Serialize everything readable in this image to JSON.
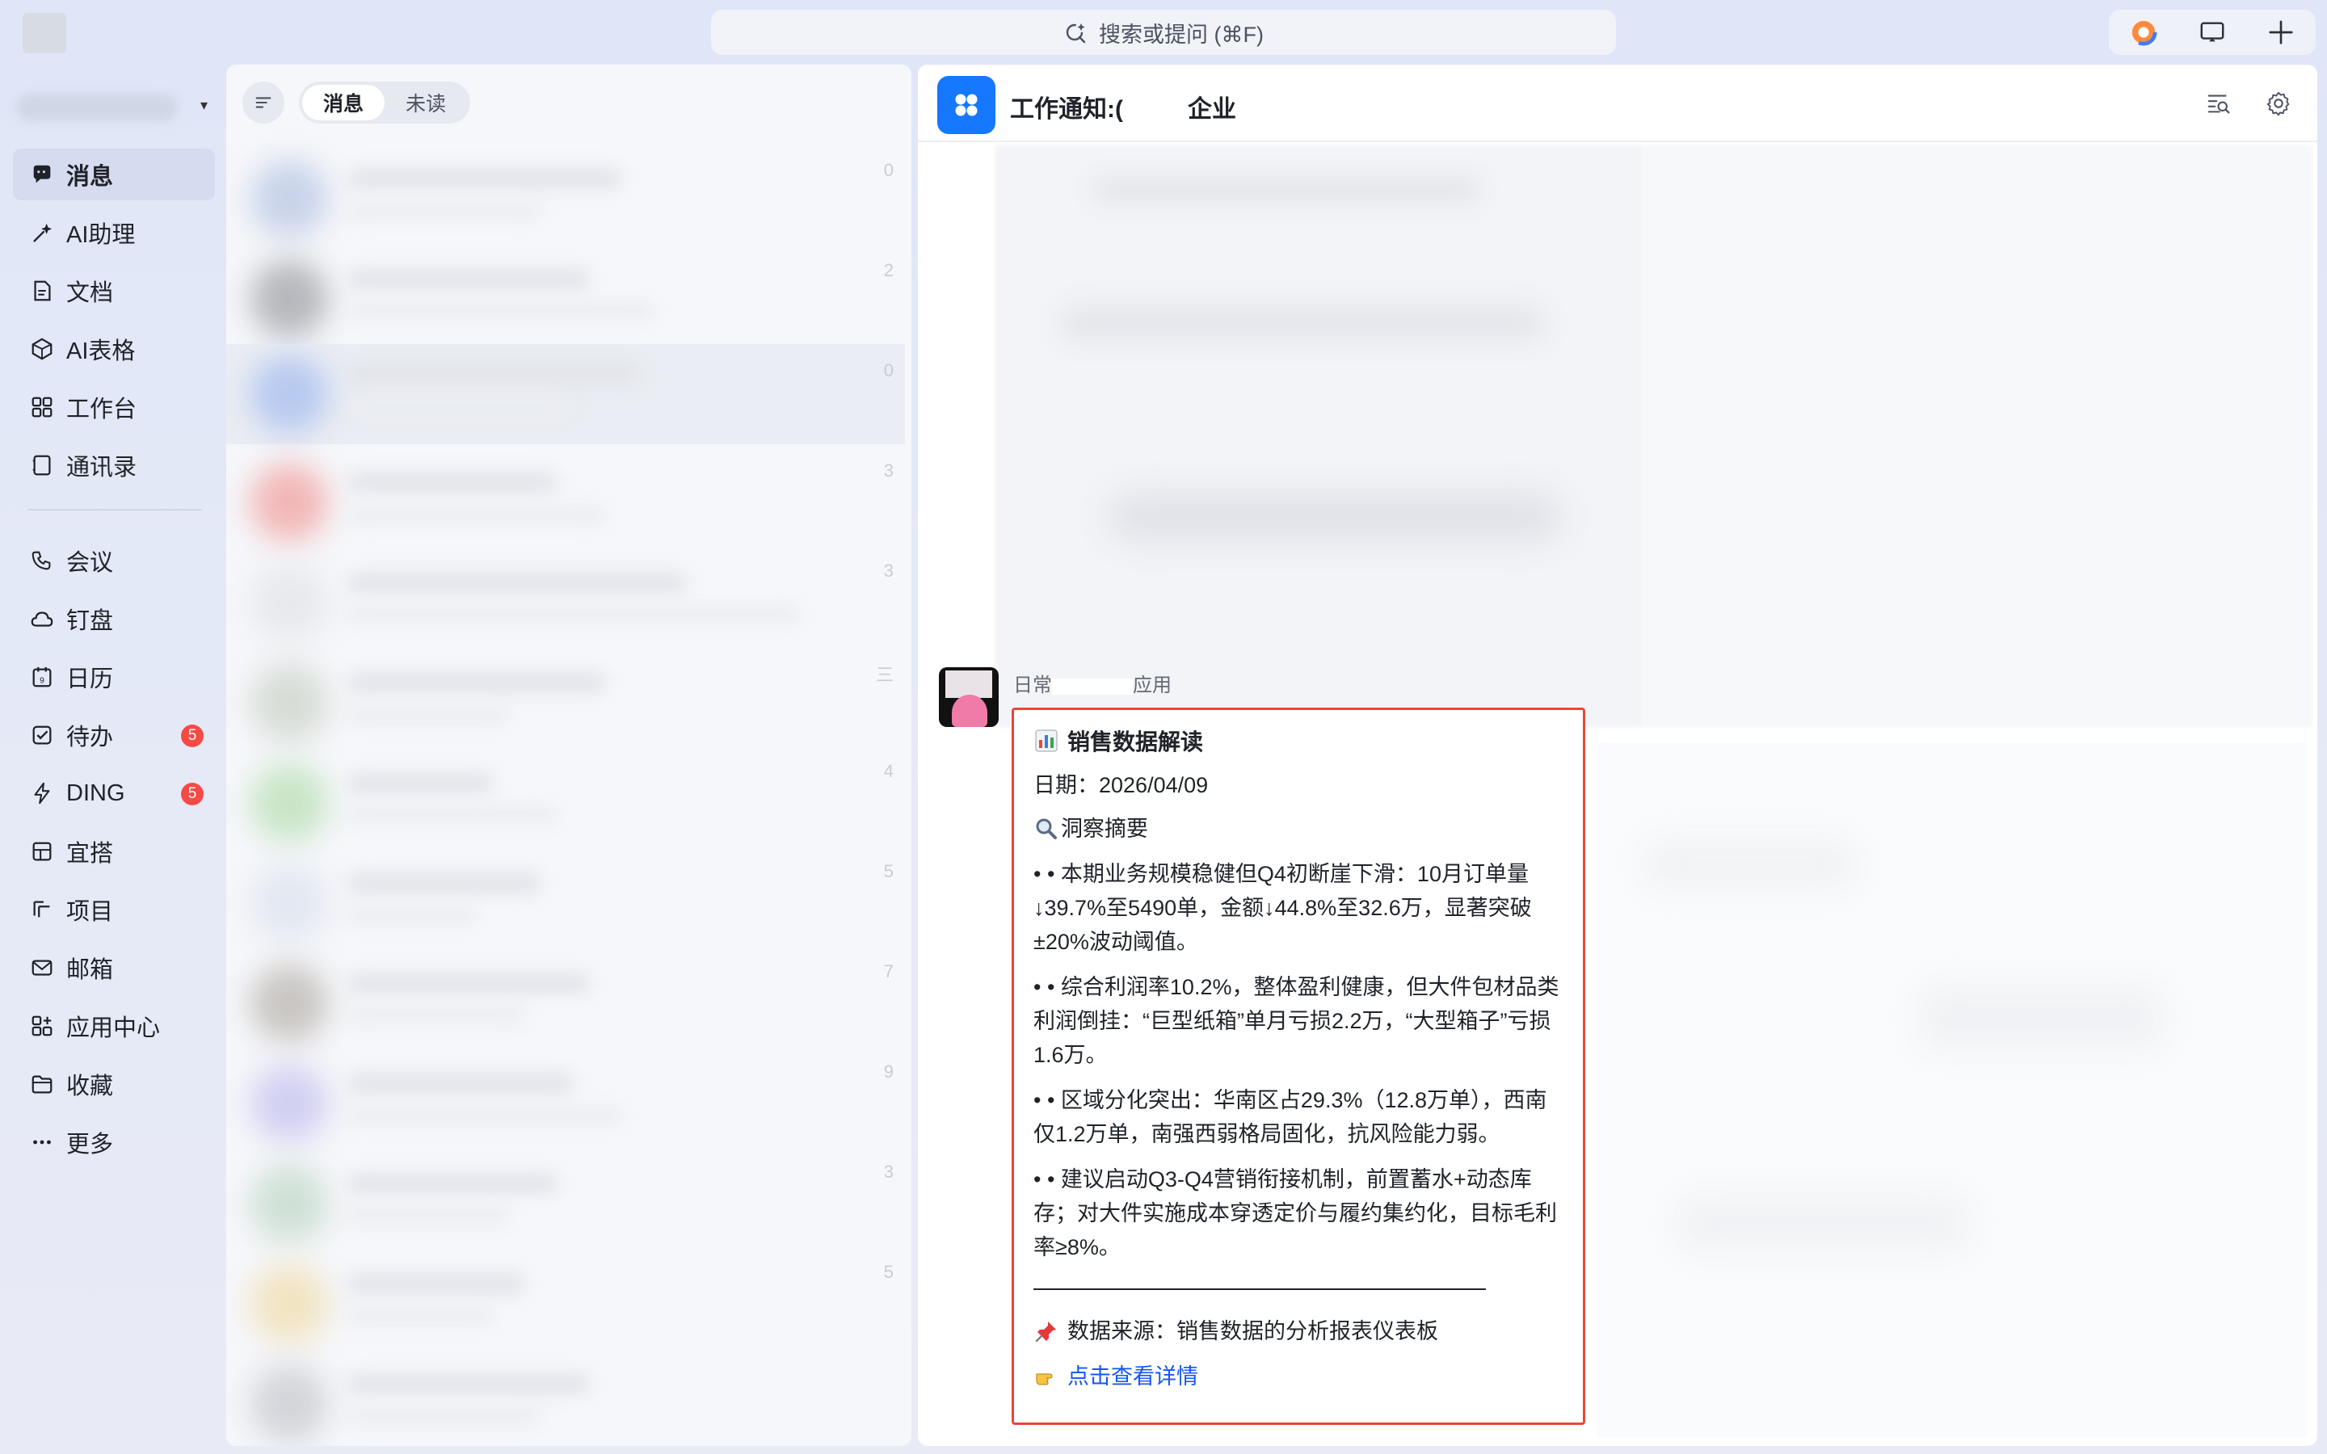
{
  "topbar": {
    "search_placeholder": "搜索或提问 (⌘F)"
  },
  "nav": {
    "items": [
      {
        "label": "消息",
        "icon": "chat-icon",
        "active": true
      },
      {
        "label": "AI助理",
        "icon": "ai-sparkle-icon"
      },
      {
        "label": "文档",
        "icon": "document-icon"
      },
      {
        "label": "AI表格",
        "icon": "ai-table-icon"
      },
      {
        "label": "工作台",
        "icon": "workbench-grid-icon"
      },
      {
        "label": "通讯录",
        "icon": "contacts-icon"
      },
      {
        "label": "会议",
        "icon": "phone-meeting-icon"
      },
      {
        "label": "钉盘",
        "icon": "cloud-drive-icon"
      },
      {
        "label": "日历",
        "icon": "calendar-icon"
      },
      {
        "label": "待办",
        "icon": "todo-check-icon",
        "badge": "5"
      },
      {
        "label": "DING",
        "icon": "lightning-icon",
        "badge": "5"
      },
      {
        "label": "宜搭",
        "icon": "form-builder-icon"
      },
      {
        "label": "项目",
        "icon": "project-icon"
      },
      {
        "label": "邮箱",
        "icon": "mail-icon"
      },
      {
        "label": "应用中心",
        "icon": "app-center-icon"
      },
      {
        "label": "收藏",
        "icon": "favorites-folder-icon"
      },
      {
        "label": "更多",
        "icon": "more-dots-icon"
      }
    ]
  },
  "chat_list": {
    "tabs": [
      {
        "label": "消息",
        "active": true
      },
      {
        "label": "未读"
      }
    ],
    "scroll_digits": [
      "0",
      "2",
      "0",
      "3",
      "3",
      "三",
      "4",
      "5",
      "7",
      "9",
      "3",
      "5"
    ]
  },
  "chat": {
    "title": "工作通知:(",
    "title_suffix": "企业",
    "sender_prefix": "日常",
    "sender_suffix": "应用",
    "card": {
      "title": "销售数据解读",
      "date": "日期：2026/04/09",
      "summary_heading": "洞察摘要",
      "bullets": [
        "• • 本期业务规模稳健但Q4初断崖下滑：10月订单量↓39.7%至5490单，金额↓44.8%至32.6万，显著突破±20%波动阈值。",
        "• • 综合利润率10.2%，整体盈利健康，但大件包材品类利润倒挂：“巨型纸箱”单月亏损2.2万，“大型箱子”亏损1.6万。",
        "• • 区域分化突出：华南区占29.3%（12.8万单），西南仅1.2万单，南强西弱格局固化，抗风险能力弱。",
        "• • 建议启动Q3-Q4营销衔接机制，前置蓄水+动态库存；对大件实施成本穿透定价与履约集约化，目标毛利率≥8%。"
      ],
      "source": "数据来源：销售数据的分析报表仪表板",
      "link": "点击查看详情"
    }
  },
  "colors": {
    "accent_blue": "#1677ff",
    "badge_red": "#f54a45",
    "highlight_border": "#e7473a",
    "link_blue": "#1456f0"
  }
}
